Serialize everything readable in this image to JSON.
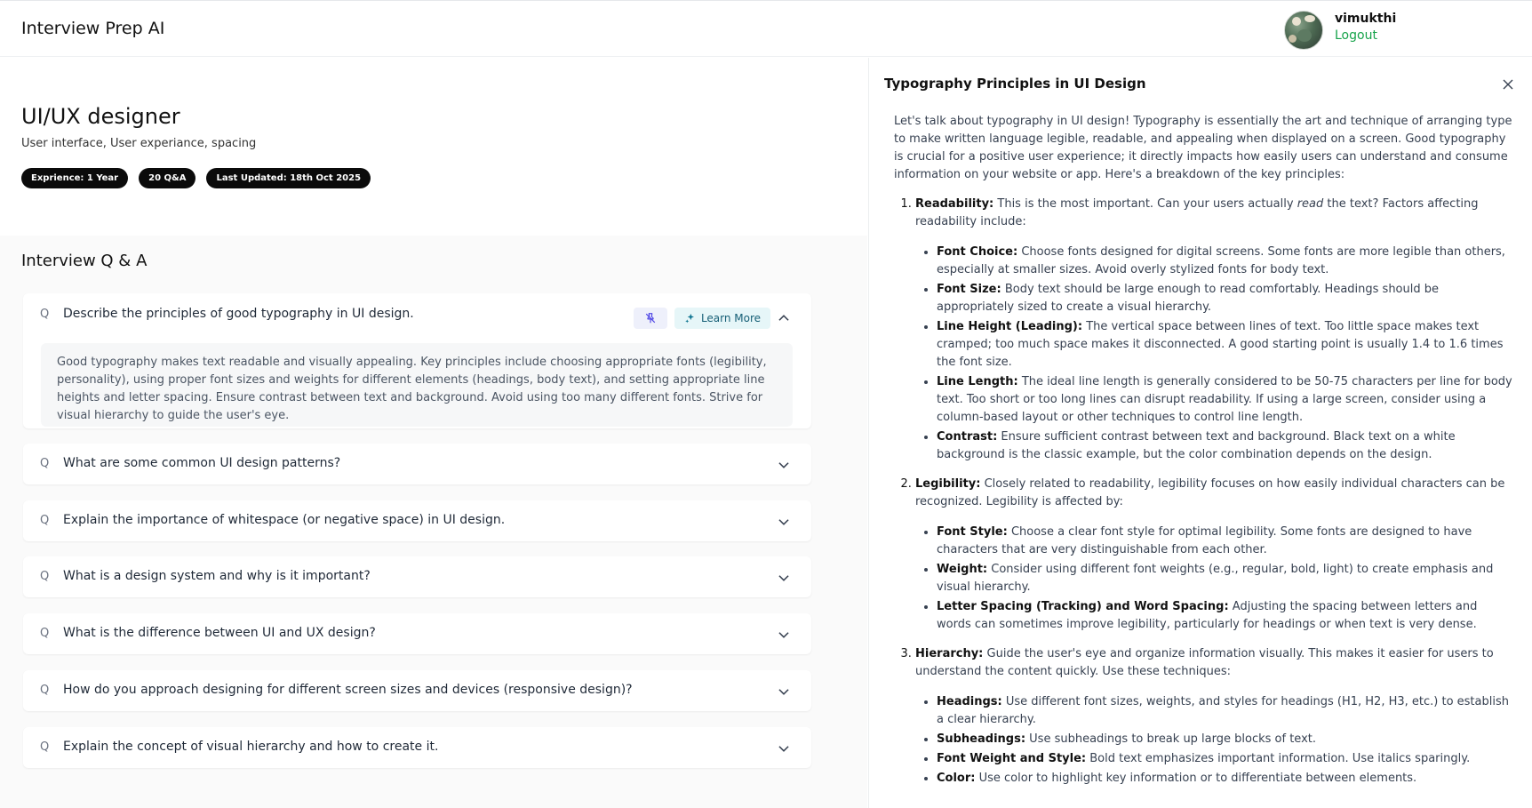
{
  "app": {
    "title": "Interview Prep AI"
  },
  "user": {
    "name": "vimukthi",
    "logout_label": "Logout"
  },
  "session": {
    "role": "UI/UX designer",
    "topics": "User interface, User experiance, spacing",
    "experience_badge": "Exprience: 1 Year",
    "qa_count_badge": "20 Q&A",
    "updated_badge": "Last Updated: 18th Oct 2025"
  },
  "qa": {
    "heading": "Interview Q & A",
    "q_marker": "Q",
    "learn_more_label": "Learn More",
    "items": [
      {
        "question": "Describe the principles of good typography in UI design.",
        "answer": "Good typography makes text readable and visually appealing. Key principles include choosing appropriate fonts (legibility, personality), using proper font sizes and weights for different elements (headings, body text), and setting appropriate line heights and letter spacing. Ensure contrast between text and background. Avoid using too many different fonts. Strive for visual hierarchy to guide the user's eye.",
        "expanded": true
      },
      {
        "question": "What are some common UI design patterns?",
        "expanded": false
      },
      {
        "question": "Explain the importance of whitespace (or negative space) in UI design.",
        "expanded": false
      },
      {
        "question": "What is a design system and why is it important?",
        "expanded": false
      },
      {
        "question": "What is the difference between UI and UX design?",
        "expanded": false
      },
      {
        "question": "How do you approach designing for different screen sizes and devices (responsive design)?",
        "expanded": false
      },
      {
        "question": "Explain the concept of visual hierarchy and how to create it.",
        "expanded": false
      }
    ]
  },
  "drawer": {
    "title": "Typography Principles in UI Design",
    "intro": "Let's talk about typography in UI design! Typography is essentially the art and technique of arranging type to make written language legible, readable, and appealing when displayed on a screen. Good typography is crucial for a positive user experience; it directly impacts how easily users can understand and consume information on your website or app. Here's a breakdown of the key principles:",
    "sections": [
      {
        "title": "Readability:",
        "text_before": "This is the most important. Can your users actually",
        "emphasis": "read",
        "text_after": "the text? Factors affecting readability include:",
        "points": [
          {
            "term": "Font Choice:",
            "text": "Choose fonts designed for digital screens. Some fonts are more legible than others, especially at smaller sizes. Avoid overly stylized fonts for body text."
          },
          {
            "term": "Font Size:",
            "text": "Body text should be large enough to read comfortably. Headings should be appropriately sized to create a visual hierarchy."
          },
          {
            "term": "Line Height (Leading):",
            "text": "The vertical space between lines of text. Too little space makes text cramped; too much space makes it disconnected. A good starting point is usually 1.4 to 1.6 times the font size."
          },
          {
            "term": "Line Length:",
            "text": "The ideal line length is generally considered to be 50-75 characters per line for body text. Too short or too long lines can disrupt readability. If using a large screen, consider using a column-based layout or other techniques to control line length."
          },
          {
            "term": "Contrast:",
            "text": "Ensure sufficient contrast between text and background. Black text on a white background is the classic example, but the color combination depends on the design."
          }
        ]
      },
      {
        "title": "Legibility:",
        "text": "Closely related to readability, legibility focuses on how easily individual characters can be recognized. Legibility is affected by:",
        "points": [
          {
            "term": "Font Style:",
            "text": "Choose a clear font style for optimal legibility. Some fonts are designed to have characters that are very distinguishable from each other."
          },
          {
            "term": "Weight:",
            "text": "Consider using different font weights (e.g., regular, bold, light) to create emphasis and visual hierarchy."
          },
          {
            "term": "Letter Spacing (Tracking) and Word Spacing:",
            "text": "Adjusting the spacing between letters and words can sometimes improve legibility, particularly for headings or when text is very dense."
          }
        ]
      },
      {
        "title": "Hierarchy:",
        "text": "Guide the user's eye and organize information visually. This makes it easier for users to understand the content quickly. Use these techniques:",
        "points": [
          {
            "term": "Headings:",
            "text": "Use different font sizes, weights, and styles for headings (H1, H2, H3, etc.) to establish a clear hierarchy."
          },
          {
            "term": "Subheadings:",
            "text": "Use subheadings to break up large blocks of text."
          },
          {
            "term": "Font Weight and Style:",
            "text": "Bold text emphasizes important information. Use italics sparingly."
          },
          {
            "term": "Color:",
            "text": "Use color to highlight key information or to differentiate between elements."
          }
        ]
      }
    ]
  },
  "colors": {
    "accent_green": "#16a34a",
    "badge_black": "#0b0b0b",
    "learn_more_bg": "#e6f6f8",
    "pin_bg": "#eef0fb"
  },
  "icons": {
    "close": "close-icon",
    "pin": "pin-off-icon",
    "sparkle": "sparkle-icon",
    "chevron_up": "chevron-up-icon",
    "chevron_down": "chevron-down-icon"
  }
}
